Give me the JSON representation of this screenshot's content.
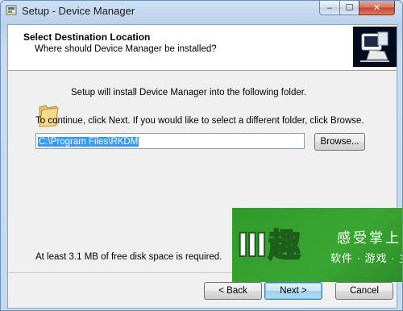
{
  "window": {
    "title": "Setup - Device Manager",
    "controls": {
      "minimize": "‒",
      "maximize": "☐",
      "close": "✕"
    }
  },
  "header": {
    "title": "Select Destination Location",
    "subtitle": "Where should Device Manager be installed?"
  },
  "body": {
    "install_text": "Setup will install Device Manager into the following folder.",
    "continue_text": "To continue, click Next. If you would like to select a different folder, click Browse.",
    "path_value": "C:\\Program Files\\RKDM",
    "browse_label": "Browse...",
    "space_text": "At least 3.1 MB of free disk space is required."
  },
  "buttons": {
    "back": "< Back",
    "next": "Next >",
    "cancel": "Cancel"
  },
  "watermark": {
    "brand": "Ⅲ趣",
    "line1": "感受掌上",
    "line2": "软件 · 游戏 · 主"
  },
  "colors": {
    "accent": "#3399ff",
    "watermark_green": "#3aa632"
  },
  "icons": {
    "app": "setup-icon",
    "folder": "folder-icon",
    "logo": "installer-logo-icon"
  }
}
